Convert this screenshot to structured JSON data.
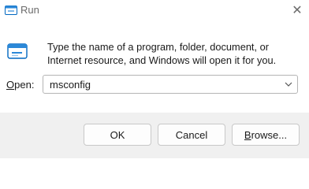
{
  "window": {
    "title": "Run",
    "close_glyph": "✕",
    "title_icon": "run-icon",
    "close_icon": "close-icon"
  },
  "content": {
    "description": "Type the name of a program, folder, document, or Internet resource, and Windows will open it for you.",
    "big_icon": "run-icon",
    "open_label_access_key": "O",
    "open_label_rest": "pen:",
    "open_value": "msconfig",
    "dropdown_icon": "chevron-down-icon"
  },
  "buttons": {
    "ok_label": "OK",
    "cancel_label": "Cancel",
    "browse_access_key": "B",
    "browse_rest": "rowse..."
  },
  "colors": {
    "accent": "#0067c0",
    "footer_bg": "#f0f0f0"
  }
}
